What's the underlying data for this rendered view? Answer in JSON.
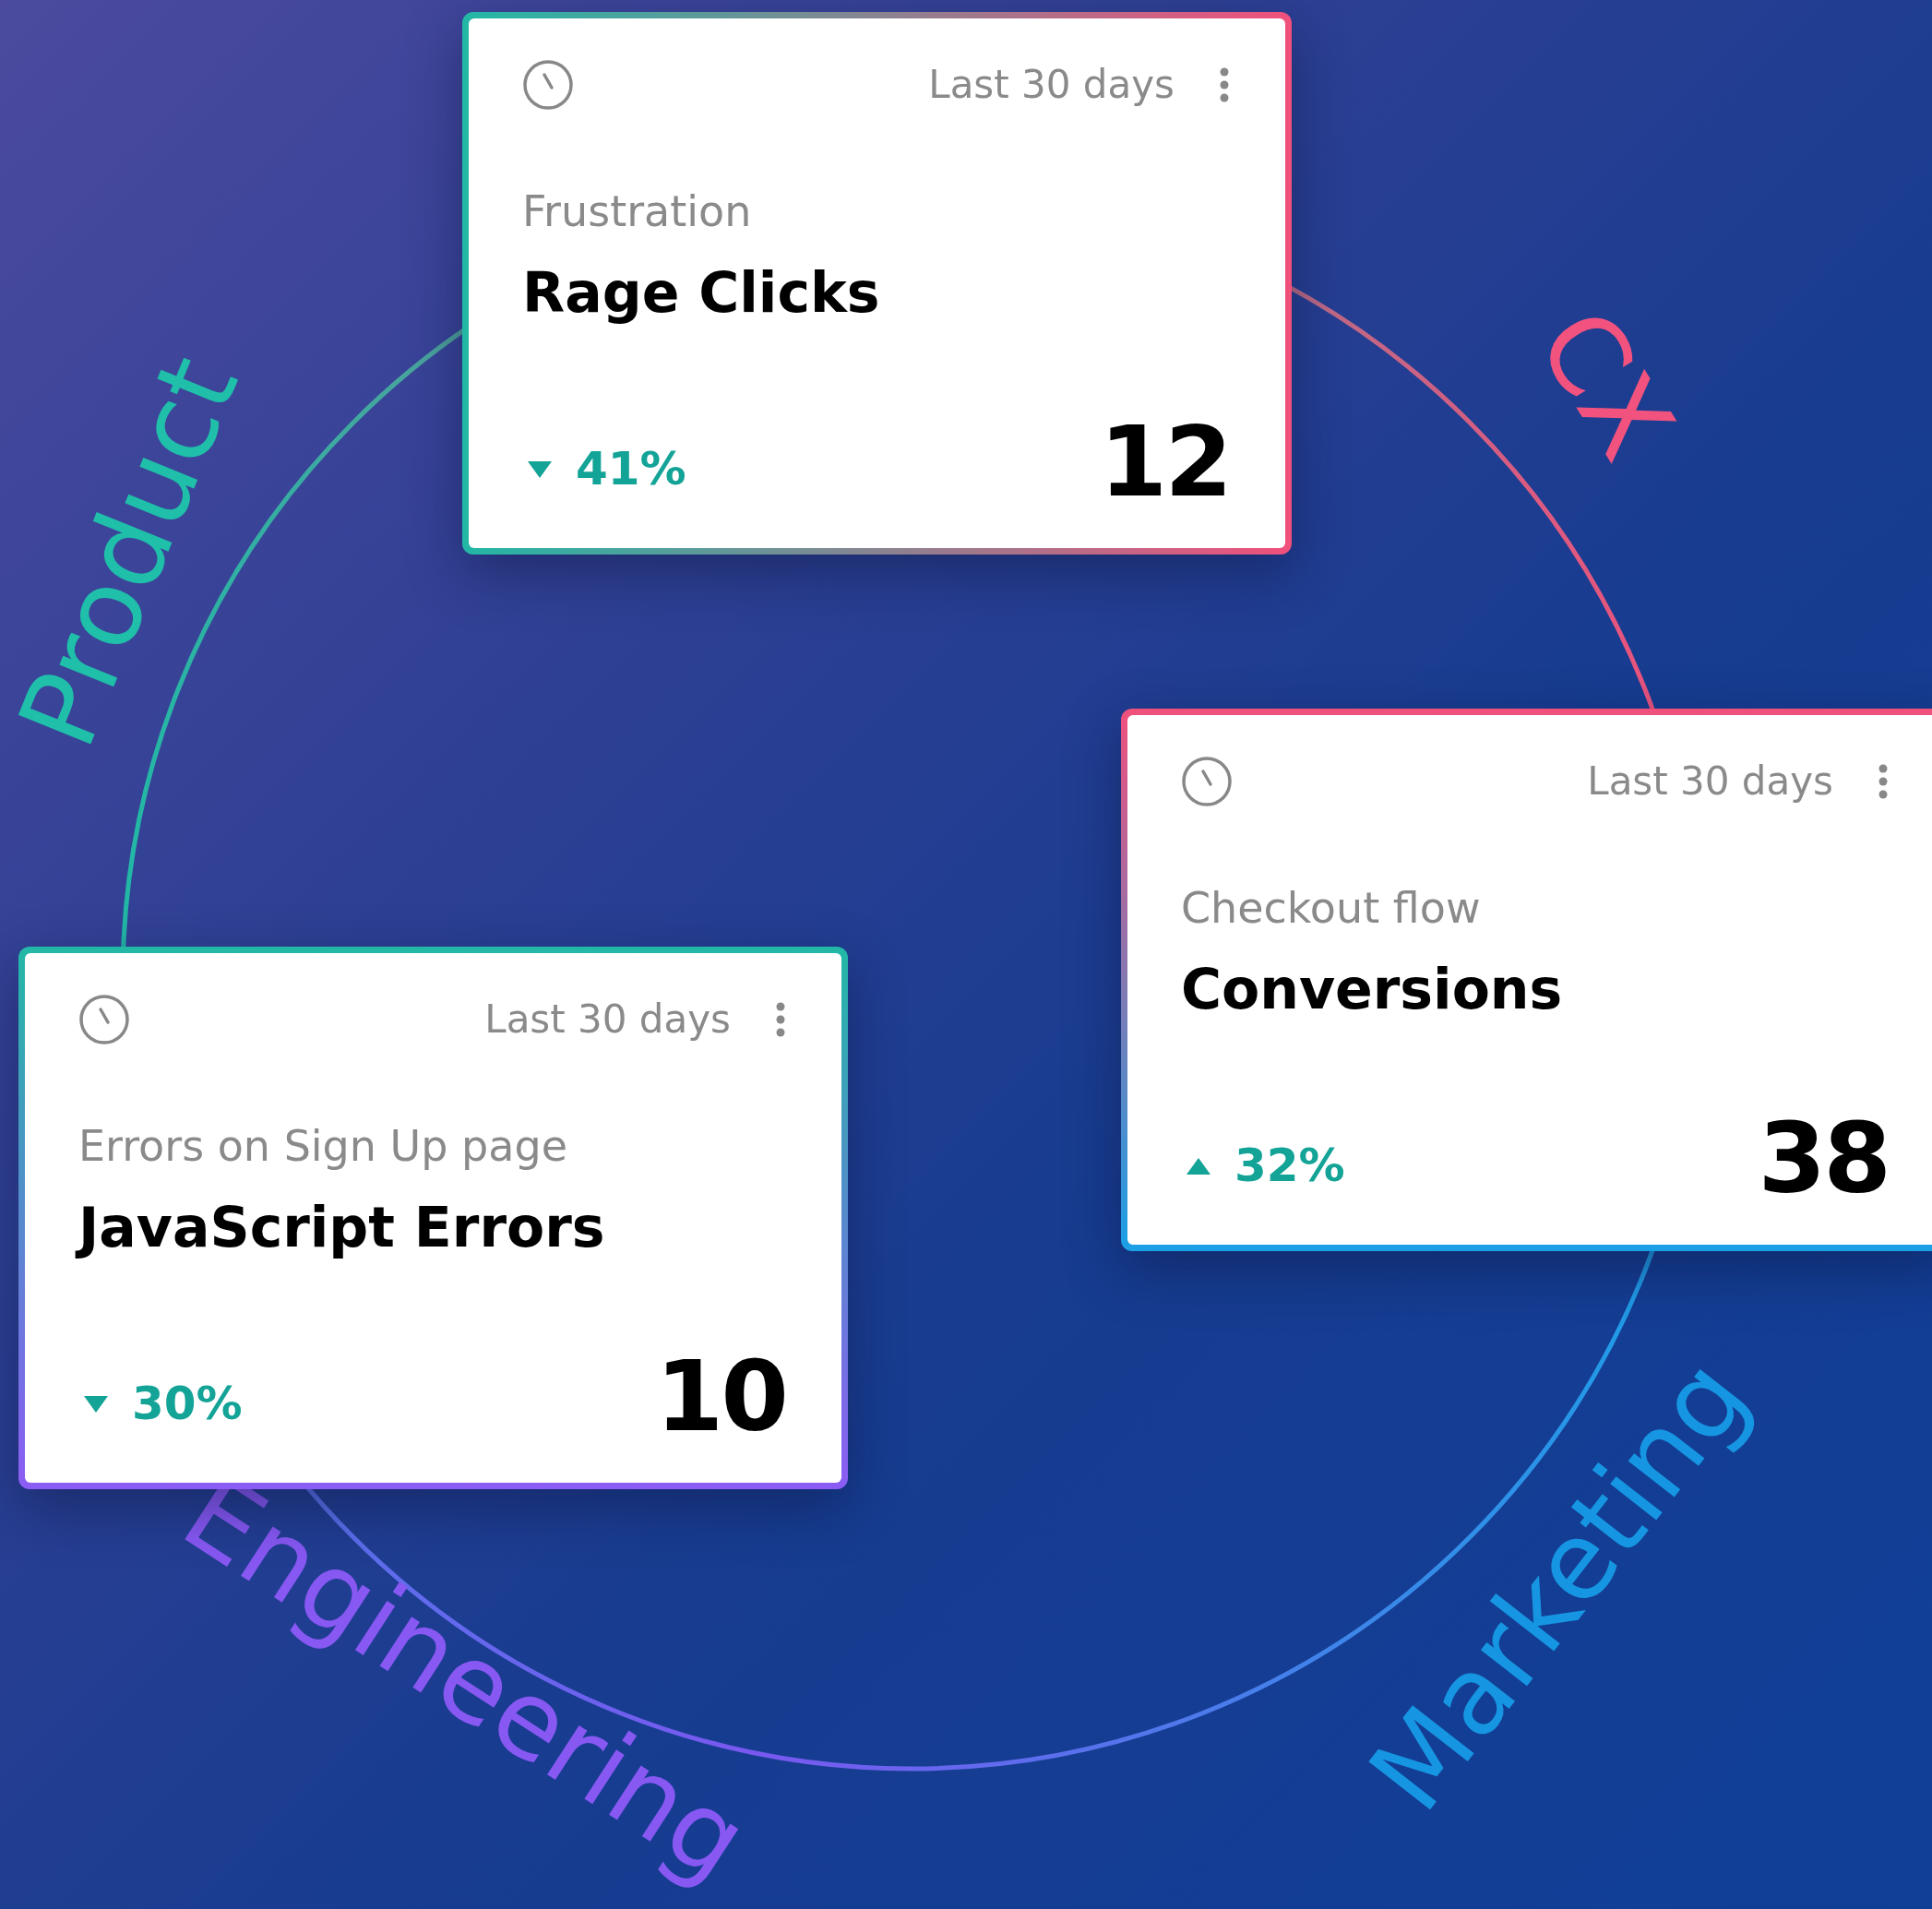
{
  "ring_labels": [
    {
      "text": "Product",
      "color": "#1fbfaa"
    },
    {
      "text": "CX",
      "color": "#f2527e"
    },
    {
      "text": "Engineering",
      "color": "#8758f2"
    },
    {
      "text": "Marketing",
      "color": "#1696e2"
    }
  ],
  "cards": [
    {
      "date_range": "Last 30 days",
      "category": "Frustration",
      "title": "Rage Clicks",
      "increase": false,
      "change": "41%",
      "value": "12"
    },
    {
      "date_range": "Last 30 days",
      "category": "Checkout flow",
      "title": "Conversions",
      "increase": true,
      "change": "32%",
      "value": "38"
    },
    {
      "date_range": "Last 30 days",
      "category": "Errors on Sign Up page",
      "title": "JavaScript Errors",
      "increase": false,
      "change": "30%",
      "value": "10"
    }
  ]
}
